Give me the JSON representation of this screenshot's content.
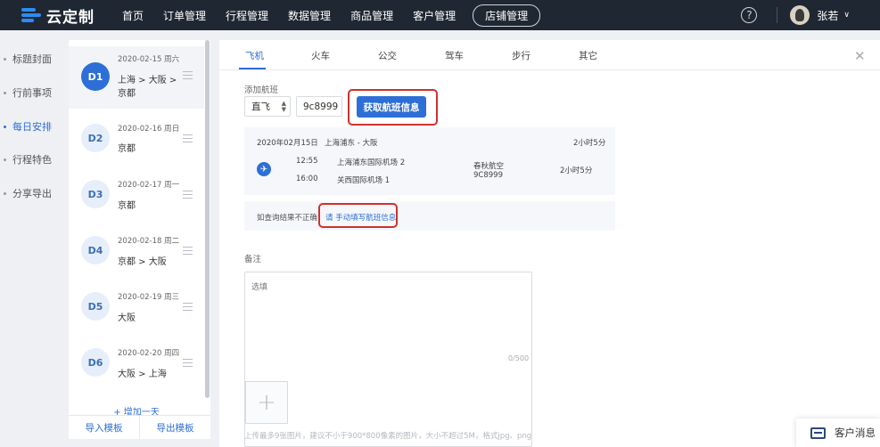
{
  "app": {
    "logo_text": "云定制"
  },
  "nav": {
    "items": [
      "首页",
      "订单管理",
      "行程管理",
      "数据管理",
      "商品管理",
      "客户管理"
    ],
    "store": "店铺管理"
  },
  "user": {
    "help": "?",
    "name": "张若",
    "caret": "∨"
  },
  "left_menu": [
    {
      "label": "标题封面",
      "active": false
    },
    {
      "label": "行前事项",
      "active": false
    },
    {
      "label": "每日安排",
      "active": true
    },
    {
      "label": "行程特色",
      "active": false
    },
    {
      "label": "分享导出",
      "active": false
    }
  ],
  "days": [
    {
      "badge": "D1",
      "date": "2020-02-15 周六",
      "route": [
        "上海 > 大阪 >",
        "京都"
      ]
    },
    {
      "badge": "D2",
      "date": "2020-02-16 周日",
      "route": [
        "京都"
      ]
    },
    {
      "badge": "D3",
      "date": "2020-02-17 周一",
      "route": [
        "京都"
      ]
    },
    {
      "badge": "D4",
      "date": "2020-02-18 周二",
      "route": [
        "京都 > 大阪"
      ]
    },
    {
      "badge": "D5",
      "date": "2020-02-19 周三",
      "route": [
        "大阪"
      ]
    },
    {
      "badge": "D6",
      "date": "2020-02-20 周四",
      "route": [
        "大阪 > 上海"
      ]
    }
  ],
  "day_panel": {
    "add_day": "+ 增加一天",
    "import": "导入模板",
    "export": "导出模板"
  },
  "tabs": [
    "飞机",
    "火车",
    "公交",
    "驾车",
    "步行",
    "其它"
  ],
  "form": {
    "add_flight_label": "添加航班",
    "flight_type": "直飞",
    "flight_number": "9c8999",
    "get_button": "获取航班信息"
  },
  "flight": {
    "date_route": "2020年02月15日",
    "route": "上海浦东 - 大阪",
    "duration_top": "2小时5分",
    "depart_time": "12:55",
    "depart_airport": "上海浦东国际机场 2",
    "arrive_time": "16:00",
    "arrive_airport": "关西国际机场 1",
    "airline": "春秋航空",
    "flight_code": "9C8999",
    "duration": "2小时5分"
  },
  "hint": {
    "text": "如查询结果不正确",
    "link": "请 手动填写航班信息"
  },
  "notes": {
    "label": "备注",
    "placeholder": "选填",
    "count": "0/500",
    "upload_tip": "上传最多9张图片，建议不小于900*800像素的图片，大小不超过5M，格式jpg、png"
  },
  "cs_widget": {
    "label": "客户消息"
  }
}
